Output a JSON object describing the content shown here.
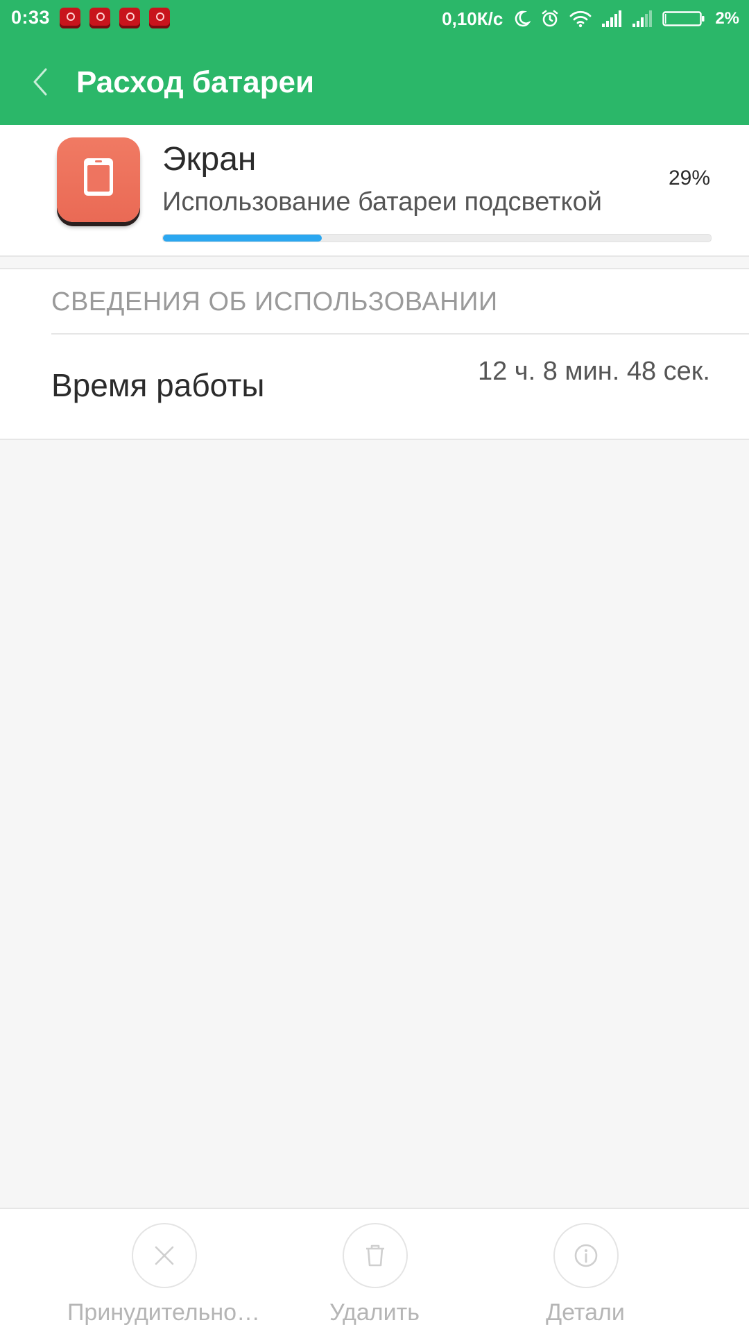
{
  "status_bar": {
    "time": "0:33",
    "notification_icons": [
      "app-notification-icon",
      "app-notification-icon",
      "app-notification-icon",
      "app-notification-icon"
    ],
    "network_speed": "0,10К/с",
    "icons": [
      "moon-icon",
      "alarm-icon",
      "wifi-icon",
      "signal-icon",
      "signal-icon",
      "battery-icon"
    ],
    "battery_percent": "2%",
    "battery_level": 0.02
  },
  "app_bar": {
    "title": "Расход батареи",
    "back_icon": "chevron-left-icon",
    "background_color": "#2bb769"
  },
  "app_header": {
    "icon": "screen-icon",
    "name": "Экран",
    "description": "Использование батареи подсветкой",
    "percent_text": "29%",
    "usage_fraction": 0.29,
    "bar_color": "#2ba7f0"
  },
  "usage_section": {
    "title": "СВЕДЕНИЯ ОБ ИСПОЛЬЗОВАНИИ",
    "rows": [
      {
        "label": "Время работы",
        "value": "12 ч. 8 мин. 48 сек."
      }
    ]
  },
  "bottom_actions": [
    {
      "icon": "close-icon",
      "label": "Принудительно…"
    },
    {
      "icon": "trash-icon",
      "label": "Удалить"
    },
    {
      "icon": "info-icon",
      "label": "Детали"
    }
  ]
}
